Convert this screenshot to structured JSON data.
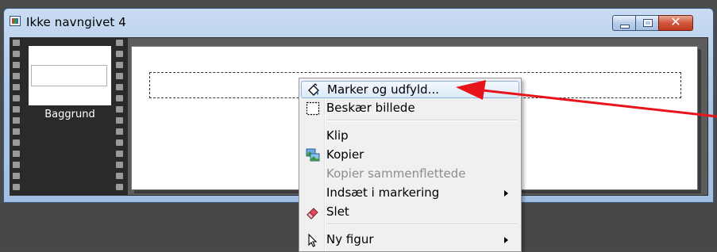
{
  "window": {
    "title": "Ikke navngivet 4",
    "minimize_symbol": "",
    "maximize_symbol": "",
    "close_symbol": "✕"
  },
  "filmstrip": {
    "frames": [
      {
        "label": "Baggrund"
      }
    ]
  },
  "context_menu": {
    "items": [
      {
        "label": "Marker og udfyld...",
        "icon": "marquee-fill-icon",
        "highlighted": true
      },
      {
        "label": "Beskær billede",
        "icon": "crop-icon"
      },
      {
        "label": "Klip"
      },
      {
        "label": "Kopier",
        "icon": "copy-image-icon"
      },
      {
        "label": "Kopier sammenflettede",
        "disabled": true
      },
      {
        "label": "Indsæt i markering",
        "has_submenu": true
      },
      {
        "label": "Slet",
        "icon": "eraser-icon"
      },
      {
        "label": "Ny figur",
        "icon": "pointer-icon",
        "has_submenu": true
      }
    ]
  },
  "colors": {
    "annotation_arrow": "#e8141b",
    "menu_highlight_border": "#8db2e3",
    "close_button": "#c7432c"
  }
}
